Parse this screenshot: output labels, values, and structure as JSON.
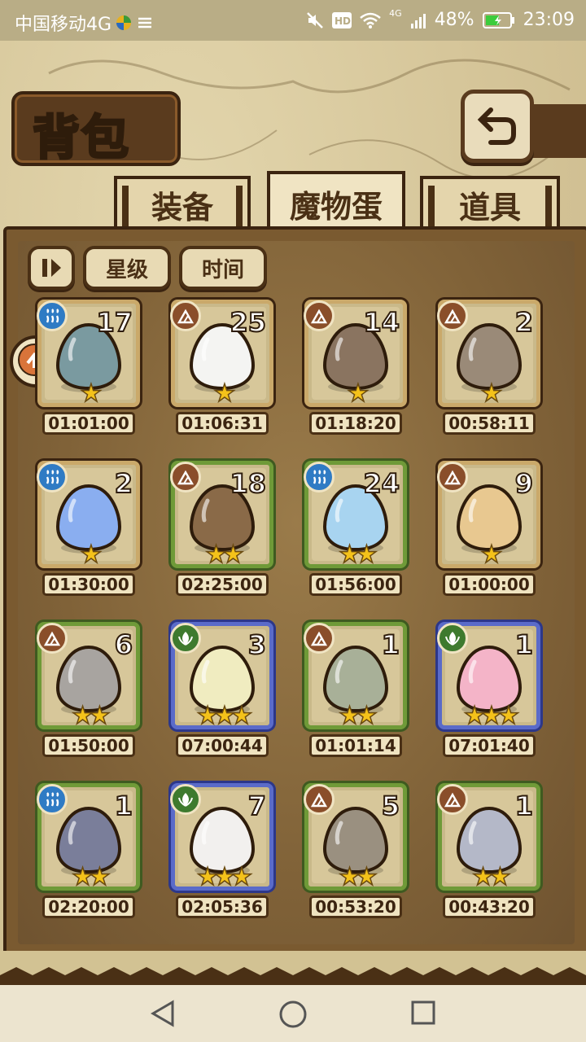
{
  "status": {
    "carrier": "中国移动4G",
    "battery": "48%",
    "time": "23:09",
    "net": "4G"
  },
  "header": {
    "title": "背包",
    "back_icon": "back-arrow-icon"
  },
  "tabs": [
    {
      "label": "装备",
      "active": false
    },
    {
      "label": "魔物蛋",
      "active": true
    },
    {
      "label": "道具",
      "active": false
    }
  ],
  "filters": {
    "sort_icon": "sort-icon",
    "star_label": "星级",
    "time_label": "时间"
  },
  "eggs": [
    {
      "element": "water",
      "count": "17",
      "stars": "★",
      "time": "01:01:00",
      "rarity": "n",
      "color": "#7a9aa0"
    },
    {
      "element": "earth",
      "count": "25",
      "stars": "★",
      "time": "01:06:31",
      "rarity": "n",
      "color": "#f4f4f2"
    },
    {
      "element": "earth",
      "count": "14",
      "stars": "★",
      "time": "01:18:20",
      "rarity": "n",
      "color": "#8a7460"
    },
    {
      "element": "earth",
      "count": "2",
      "stars": "★",
      "time": "00:58:11",
      "rarity": "n",
      "color": "#9a8a78"
    },
    {
      "element": "water",
      "count": "2",
      "stars": "★",
      "time": "01:30:00",
      "rarity": "n",
      "color": "#8aaef0"
    },
    {
      "element": "earth",
      "count": "18",
      "stars": "★★",
      "time": "02:25:00",
      "rarity": "g",
      "color": "#8a6a48"
    },
    {
      "element": "water",
      "count": "24",
      "stars": "★★",
      "time": "01:56:00",
      "rarity": "g",
      "color": "#a8d4f0"
    },
    {
      "element": "earth",
      "count": "9",
      "stars": "★",
      "time": "01:00:00",
      "rarity": "n",
      "color": "#e8c890"
    },
    {
      "element": "earth",
      "count": "6",
      "stars": "★★",
      "time": "01:50:00",
      "rarity": "g",
      "color": "#a8a4a0"
    },
    {
      "element": "wood",
      "count": "3",
      "stars": "★★★",
      "time": "07:00:44",
      "rarity": "b",
      "color": "#f0ecc0"
    },
    {
      "element": "earth",
      "count": "1",
      "stars": "★★",
      "time": "01:01:14",
      "rarity": "g",
      "color": "#a8b098"
    },
    {
      "element": "wood",
      "count": "1",
      "stars": "★★★",
      "time": "07:01:40",
      "rarity": "b",
      "color": "#f4b4c8"
    },
    {
      "element": "water",
      "count": "1",
      "stars": "★★",
      "time": "02:20:00",
      "rarity": "g",
      "color": "#7a7e9a"
    },
    {
      "element": "wood",
      "count": "7",
      "stars": "★★★",
      "time": "02:05:36",
      "rarity": "b",
      "color": "#f2f0ee"
    },
    {
      "element": "earth",
      "count": "5",
      "stars": "★★",
      "time": "00:53:20",
      "rarity": "g",
      "color": "#9a9080"
    },
    {
      "element": "earth",
      "count": "1",
      "stars": "★★",
      "time": "00:43:20",
      "rarity": "g",
      "color": "#b4b8c8"
    }
  ],
  "colors": {
    "wood_frame": "#5a3b1e",
    "star": "#f4c21a",
    "water": "#2f7bc4",
    "earth": "#8a4e2a",
    "wood_element": "#3e7a2e"
  }
}
